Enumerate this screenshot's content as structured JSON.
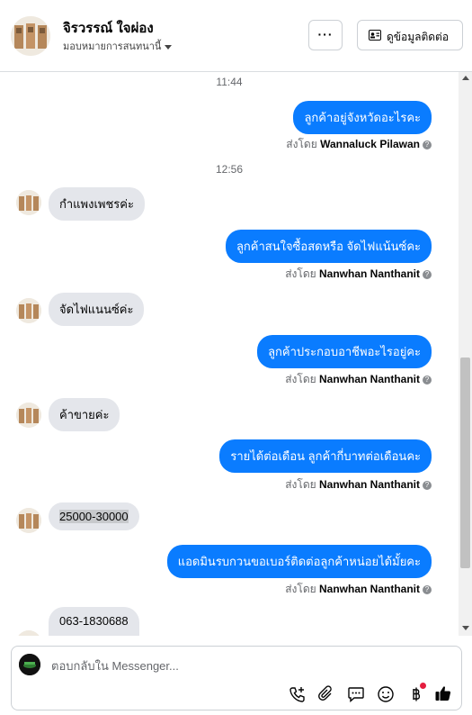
{
  "header": {
    "name": "จิรวรรณ์ ใจผ่อง",
    "subtitle": "มอบหมายการสนทนานี้",
    "more_label": "···",
    "info_label": "ดูข้อมูลติดต่อ"
  },
  "thread": {
    "timestamps": [
      "11:44",
      "12:56"
    ],
    "outgoing": [
      "ลูกค้าอยู่จังหวัดอะไรคะ",
      "ลูกค้าสนใจซื้อสดหรือ จัดไฟแน้นซ์คะ",
      "ลูกค้าประกอบอาชีพอะไรอยู่คะ",
      "รายได้ต่อเดือน ลูกค้ากี่บาทต่อเดือนคะ",
      "แอดมินรบกวนขอเบอร์ติดต่อลูกค้าหน่อยได้มั้ยคะ"
    ],
    "incoming": [
      "กำแพงเพชรค่ะ",
      "จัดไฟแนนซ์ค่ะ",
      "ค้าขายค่ะ",
      "25000-30000",
      "063-1830688"
    ],
    "sent_prefix": "ส่งโดย",
    "senders": [
      "Wannaluck Pilawan",
      "Nanwhan Nanthanit",
      "Nanwhan Nanthanit",
      "Nanwhan Nanthanit",
      "Nanwhan Nanthanit"
    ]
  },
  "composer": {
    "placeholder": "ตอบกลับใน Messenger...",
    "tools": [
      "phone-add-icon",
      "attachment-icon",
      "chat-icon",
      "emoji-icon",
      "baht-icon",
      "like-icon"
    ]
  },
  "colors": {
    "outgoing_bubble": "#0a7cff",
    "incoming_bubble": "#e4e6eb",
    "notification_dot": "#e41e3f"
  }
}
